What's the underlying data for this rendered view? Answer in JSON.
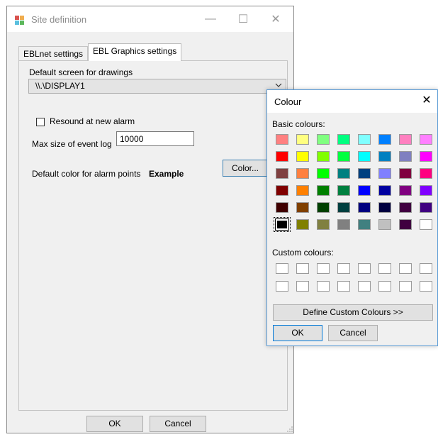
{
  "main_window": {
    "title": "Site definition",
    "minimize_glyph": "—",
    "maximize_glyph": "☐",
    "close_glyph": "✕",
    "tabs": [
      {
        "label": "EBLnet settings"
      },
      {
        "label": "EBL Graphics settings",
        "selected": true
      }
    ],
    "default_screen_label": "Default screen for drawings",
    "default_screen_value": "\\\\.\\DISPLAY1",
    "resound_label": "Resound at new alarm",
    "resound_checked": false,
    "max_log_label": "Max size of event log",
    "max_log_value": "10000",
    "alarm_color_label": "Default color for alarm points",
    "example_label": "Example",
    "color_button": "Color...",
    "ok": "OK",
    "cancel": "Cancel"
  },
  "colour_dialog": {
    "title": "Colour",
    "close_glyph": "✕",
    "basic_label": "Basic colours:",
    "basic_colours": [
      [
        "#ff8080",
        "#ffff80",
        "#80ff80",
        "#00ff80",
        "#80ffff",
        "#0080ff",
        "#ff80c0",
        "#ff80ff"
      ],
      [
        "#ff0000",
        "#ffff00",
        "#80ff00",
        "#00ff40",
        "#00ffff",
        "#0080c0",
        "#8080c0",
        "#ff00ff"
      ],
      [
        "#804040",
        "#ff8040",
        "#00ff00",
        "#008080",
        "#004080",
        "#8080ff",
        "#800040",
        "#ff0080"
      ],
      [
        "#800000",
        "#ff8000",
        "#008000",
        "#008040",
        "#0000ff",
        "#0000a0",
        "#800080",
        "#8000ff"
      ],
      [
        "#400000",
        "#804000",
        "#004000",
        "#004040",
        "#000080",
        "#000040",
        "#400040",
        "#400080"
      ],
      [
        "#000000",
        "#808000",
        "#808040",
        "#808080",
        "#408080",
        "#c0c0c0",
        "#400040",
        "#ffffff"
      ]
    ],
    "selected_colour": "#000000",
    "custom_label": "Custom colours:",
    "define_custom": "Define Custom Colours >>",
    "ok": "OK",
    "cancel": "Cancel"
  }
}
